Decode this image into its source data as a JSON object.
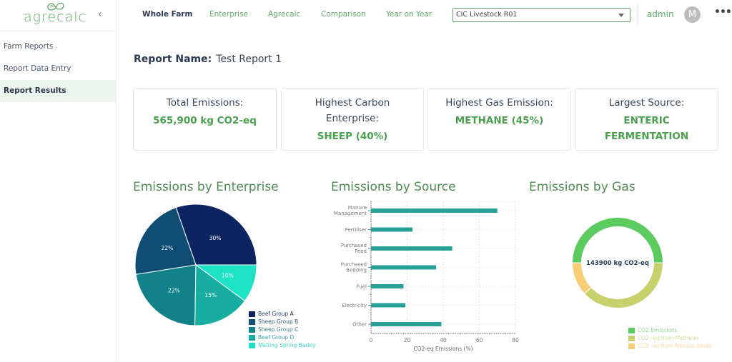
{
  "sidebar": {
    "logo_text": "agrecalc",
    "collapse_icon": "chevron-left-icon",
    "items": [
      {
        "label": "Farm Reports",
        "active": false
      },
      {
        "label": "Report Data Entry",
        "active": false
      },
      {
        "label": "Report Results",
        "active": true
      }
    ]
  },
  "topbar": {
    "tabs": [
      {
        "label": "Whole Farm",
        "active": true
      },
      {
        "label": "Enterprise",
        "active": false
      },
      {
        "label": "Agrecalc",
        "active": false
      },
      {
        "label": "Comparison",
        "active": false
      },
      {
        "label": "Year on Year",
        "active": false
      }
    ],
    "farm_select": {
      "value": "CIC Livestock R01"
    },
    "user_label": "admin",
    "avatar_initial": "M",
    "more_icon": "more-horizontal-icon"
  },
  "report": {
    "name_label": "Report Name:",
    "name_value": "Test Report 1"
  },
  "cards": [
    {
      "label": "Total Emissions:",
      "value": "565,900 kg CO2-eq"
    },
    {
      "label": "Highest Carbon Enterprise:",
      "value": "SHEEP (40%)"
    },
    {
      "label": "Highest Gas Emission:",
      "value": "METHANE (45%)"
    },
    {
      "label": "Largest Source:",
      "value": "ENTERIC FERMENTATION"
    }
  ],
  "colors": {
    "brand_green": "#5fa868",
    "value_green": "#4aa04e",
    "bar_teal": "#2aa198"
  },
  "chart_data": [
    {
      "type": "pie",
      "title": "Emissions by Enterprise",
      "categories": [
        "Beef Group A",
        "Sheep Group B",
        "Sheep Group C",
        "Beef Group D",
        "Malting Spring Barley"
      ],
      "values": [
        30,
        22,
        22,
        15,
        10
      ],
      "labels": [
        "30%",
        "22%",
        "22%",
        "15%",
        "10%"
      ],
      "colors": [
        "#0d2463",
        "#0f4d74",
        "#11818a",
        "#17ada0",
        "#1de3c4"
      ],
      "legend": "bottom-right"
    },
    {
      "type": "bar",
      "orientation": "horizontal",
      "title": "Emissions by Source",
      "categories": [
        "Manure Management",
        "Fertiliser",
        "Purchased Feed",
        "Purchased Bedding",
        "Fuel",
        "Electricity",
        "Other"
      ],
      "category_lines": [
        [
          "Manure",
          "Management"
        ],
        [
          "Fertiliser"
        ],
        [
          "Purchased",
          "Feed"
        ],
        [
          "Purchased",
          "Bedding"
        ],
        [
          "Fuel"
        ],
        [
          "Electricity"
        ],
        [
          "Other"
        ]
      ],
      "values": [
        70,
        23,
        45,
        36,
        18,
        19,
        39
      ],
      "xlabel": "CO2-eq Emissions (%)",
      "ylabel": "",
      "xlim": [
        0,
        80
      ],
      "xticks": [
        0,
        20,
        40,
        60,
        80
      ],
      "grid": true,
      "color": "#2aa198"
    },
    {
      "type": "pie",
      "variant": "donut",
      "title": "Emissions by Gas",
      "center_label": "143900 kg CO2-eq",
      "categories": [
        "CO2 Emissions",
        "CO2 -eq from Methane",
        "CO2 -eq from Nitrous Oxide"
      ],
      "values": [
        50,
        38,
        12
      ],
      "colors": [
        "#5ccb5f",
        "#c7d16b",
        "#f9cd76"
      ],
      "legend": "bottom-right"
    }
  ]
}
